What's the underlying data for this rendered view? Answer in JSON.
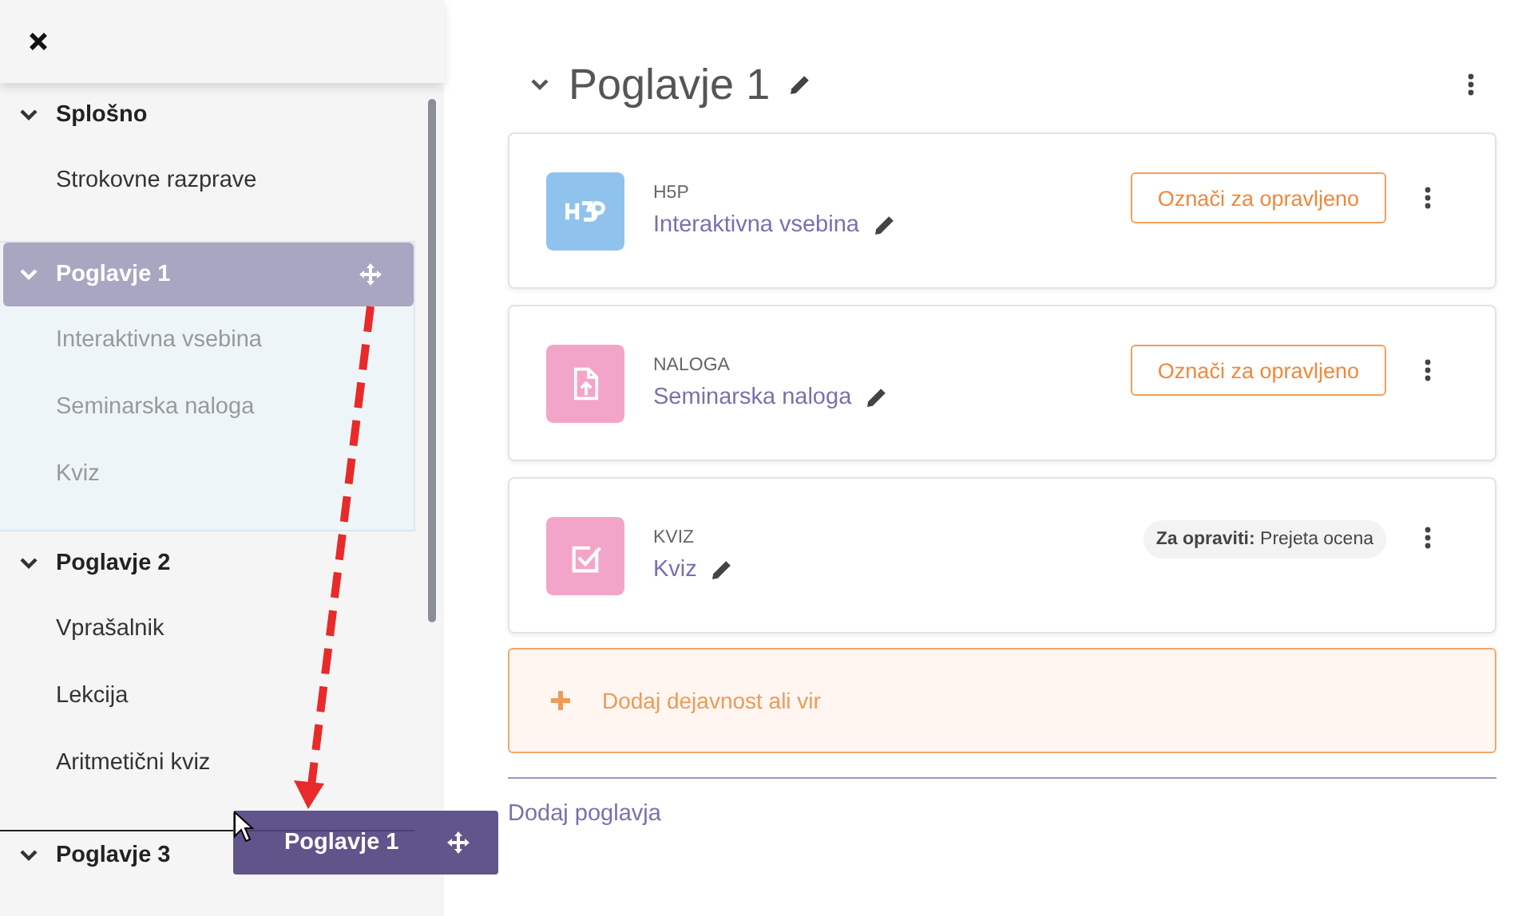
{
  "sidebar": {
    "sections": [
      {
        "title": "Splošno",
        "expanded": true,
        "dragging": false,
        "items": [
          "Strokovne razprave"
        ]
      },
      {
        "title": "Poglavje 1",
        "expanded": true,
        "dragging": true,
        "items": [
          "Interaktivna vsebina",
          "Seminarska naloga",
          "Kviz"
        ]
      },
      {
        "title": "Poglavje 2",
        "expanded": true,
        "dragging": false,
        "items": [
          "Vprašalnik",
          "Lekcija",
          "Aritmetični kviz"
        ]
      },
      {
        "title": "Poglavje 3",
        "expanded": true,
        "dragging": false
      }
    ]
  },
  "drag_ghost": {
    "title": "Poglavje 1"
  },
  "section": {
    "title": "Poglavje 1"
  },
  "activities": [
    {
      "kind": "h5p",
      "color": "#8fc3ee",
      "type_label": "H5P",
      "name": "Interaktivna vsebina",
      "completion": {
        "kind": "button",
        "label": "Označi za opravljeno"
      }
    },
    {
      "kind": "assign",
      "color": "#f3a5c9",
      "type_label": "NALOGA",
      "name": "Seminarska naloga",
      "completion": {
        "kind": "button",
        "label": "Označi za opravljeno"
      }
    },
    {
      "kind": "quiz",
      "color": "#f3a5c9",
      "type_label": "KVIZ",
      "name": "Kviz",
      "completion": {
        "kind": "condition",
        "label": "Za opraviti:",
        "value": "Prejeta ocena"
      }
    }
  ],
  "add_activity": "Dodaj dejavnost ali vir",
  "add_section": "Dodaj poglavja"
}
